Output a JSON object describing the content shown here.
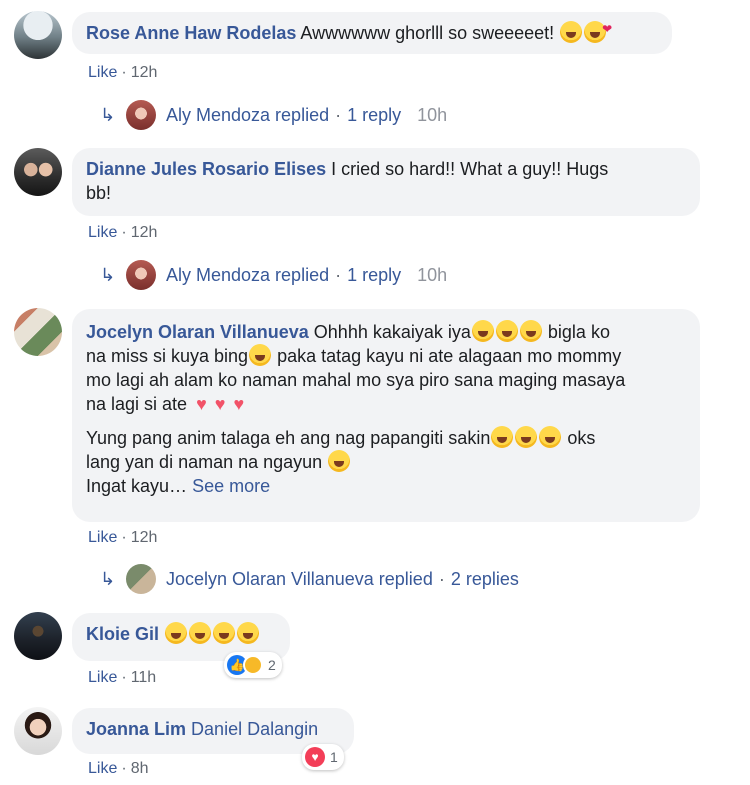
{
  "comments": [
    {
      "author": "Rose Anne Haw Rodelas",
      "text": "Awwwwww ghorlll so sweeeeet!",
      "like_label": "Like",
      "time": "12h",
      "reply": {
        "name": "Aly Mendoza replied",
        "count": "1 reply",
        "time": "10h"
      }
    },
    {
      "author": "Dianne Jules Rosario Elises",
      "text": "I cried so hard!! What a guy!! Hugs",
      "text_line2": "bb!",
      "like_label": "Like",
      "time": "12h",
      "reply": {
        "name": "Aly Mendoza replied",
        "count": "1 reply",
        "time": "10h"
      }
    },
    {
      "author": "Jocelyn Olaran Villanueva",
      "text_p1_l1a": "Ohhhh kakaiyak iya",
      "text_p1_l1b": "bigla ko",
      "text_p1_l2a": "na miss si kuya bing",
      "text_p1_l2b": "paka tatag kayu ni ate alagaan mo mommy",
      "text_p1_l3": "mo lagi ah alam ko naman mahal mo sya piro sana maging masaya",
      "text_p1_l4": "na lagi si ate",
      "text_p2_l1a": "Yung pang anim talaga eh ang nag papangiti sakin",
      "text_p2_l1b": "oks",
      "text_p2_l2": "lang yan di naman na ngayun",
      "text_p2_l3": "Ingat kayu…",
      "see_more": "See more",
      "like_label": "Like",
      "time": "12h",
      "reply": {
        "name": "Jocelyn Olaran Villanueva replied",
        "count": "2 replies"
      }
    },
    {
      "author": "Kloie Gil",
      "like_label": "Like",
      "time": "11h",
      "reactions": "2"
    },
    {
      "author": "Joanna Lim",
      "mention": "Daniel Dalangin",
      "like_label": "Like",
      "time": "8h",
      "reactions": "1"
    }
  ],
  "separator": "·",
  "icons": {
    "reply": "reply-arrow-icon",
    "like": "like-reaction-icon",
    "love": "love-reaction-icon"
  }
}
